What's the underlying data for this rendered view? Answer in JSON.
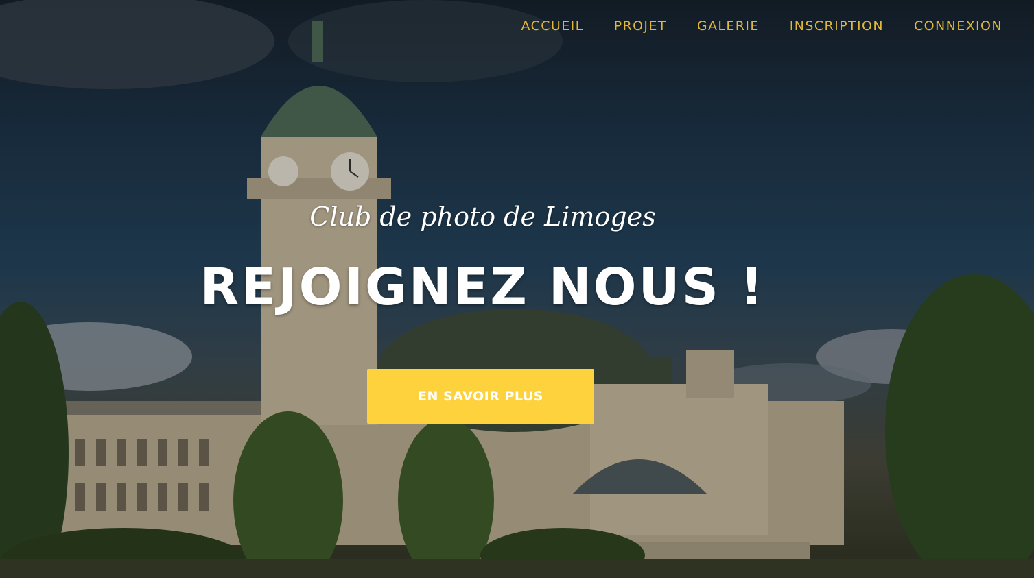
{
  "nav": {
    "items": [
      {
        "label": "ACCUEIL"
      },
      {
        "label": "PROJET"
      },
      {
        "label": "GALERIE"
      },
      {
        "label": "INSCRIPTION"
      },
      {
        "label": "CONNEXION"
      }
    ]
  },
  "hero": {
    "subtitle": "Club de photo de Limoges",
    "headline": "REJOIGNEZ NOUS !",
    "cta_label": "EN SAVOIR PLUS"
  },
  "colors": {
    "nav_text": "#e2b83a",
    "cta_background": "#fdd23c",
    "text": "#ffffff"
  }
}
